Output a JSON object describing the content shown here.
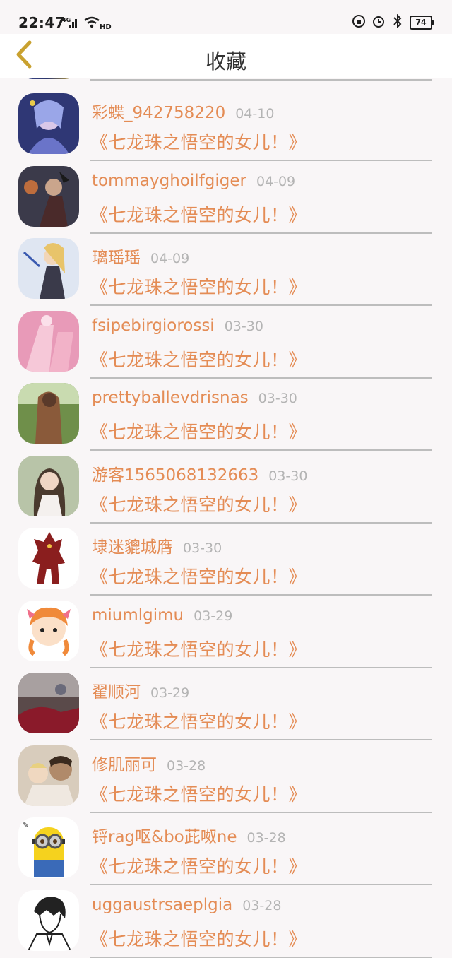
{
  "status_bar": {
    "time": "22:47",
    "network": "4G",
    "hd": "HD",
    "battery": "74"
  },
  "header": {
    "title": "收藏"
  },
  "colors": {
    "accent": "#e48c55",
    "date": "#b4b4b4",
    "divider": "#bdbdbd",
    "back": "#c9a12f"
  },
  "items": [
    {
      "name": "彩蝶_942758220",
      "date": "04-10",
      "work": "《七龙珠之悟空的女儿！》"
    },
    {
      "name": "tommayghoilfgiger",
      "date": "04-09",
      "work": "《七龙珠之悟空的女儿！》"
    },
    {
      "name": "璃瑶瑶",
      "date": "04-09",
      "work": "《七龙珠之悟空的女儿！》"
    },
    {
      "name": "fsipebirgiorossi",
      "date": "03-30",
      "work": "《七龙珠之悟空的女儿！》"
    },
    {
      "name": "prettyballevdrisnas",
      "date": "03-30",
      "work": "《七龙珠之悟空的女儿！》"
    },
    {
      "name": "游客1565068132663",
      "date": "03-30",
      "work": "《七龙珠之悟空的女儿！》"
    },
    {
      "name": "埭迷貔城膺",
      "date": "03-30",
      "work": "《七龙珠之悟空的女儿！》"
    },
    {
      "name": "miumlgimu",
      "date": "03-29",
      "work": "《七龙珠之悟空的女儿！》"
    },
    {
      "name": "翟顺河",
      "date": "03-29",
      "work": "《七龙珠之悟空的女儿！》"
    },
    {
      "name": "修肌丽可",
      "date": "03-28",
      "work": "《七龙珠之悟空的女儿！》"
    },
    {
      "name": "锊rag呕&bo茈呶ne",
      "date": "03-28",
      "work": "《七龙珠之悟空的女儿！》"
    },
    {
      "name": "uggaustrsaeplgia",
      "date": "03-28",
      "work": "《七龙珠之悟空的女儿！》"
    }
  ]
}
